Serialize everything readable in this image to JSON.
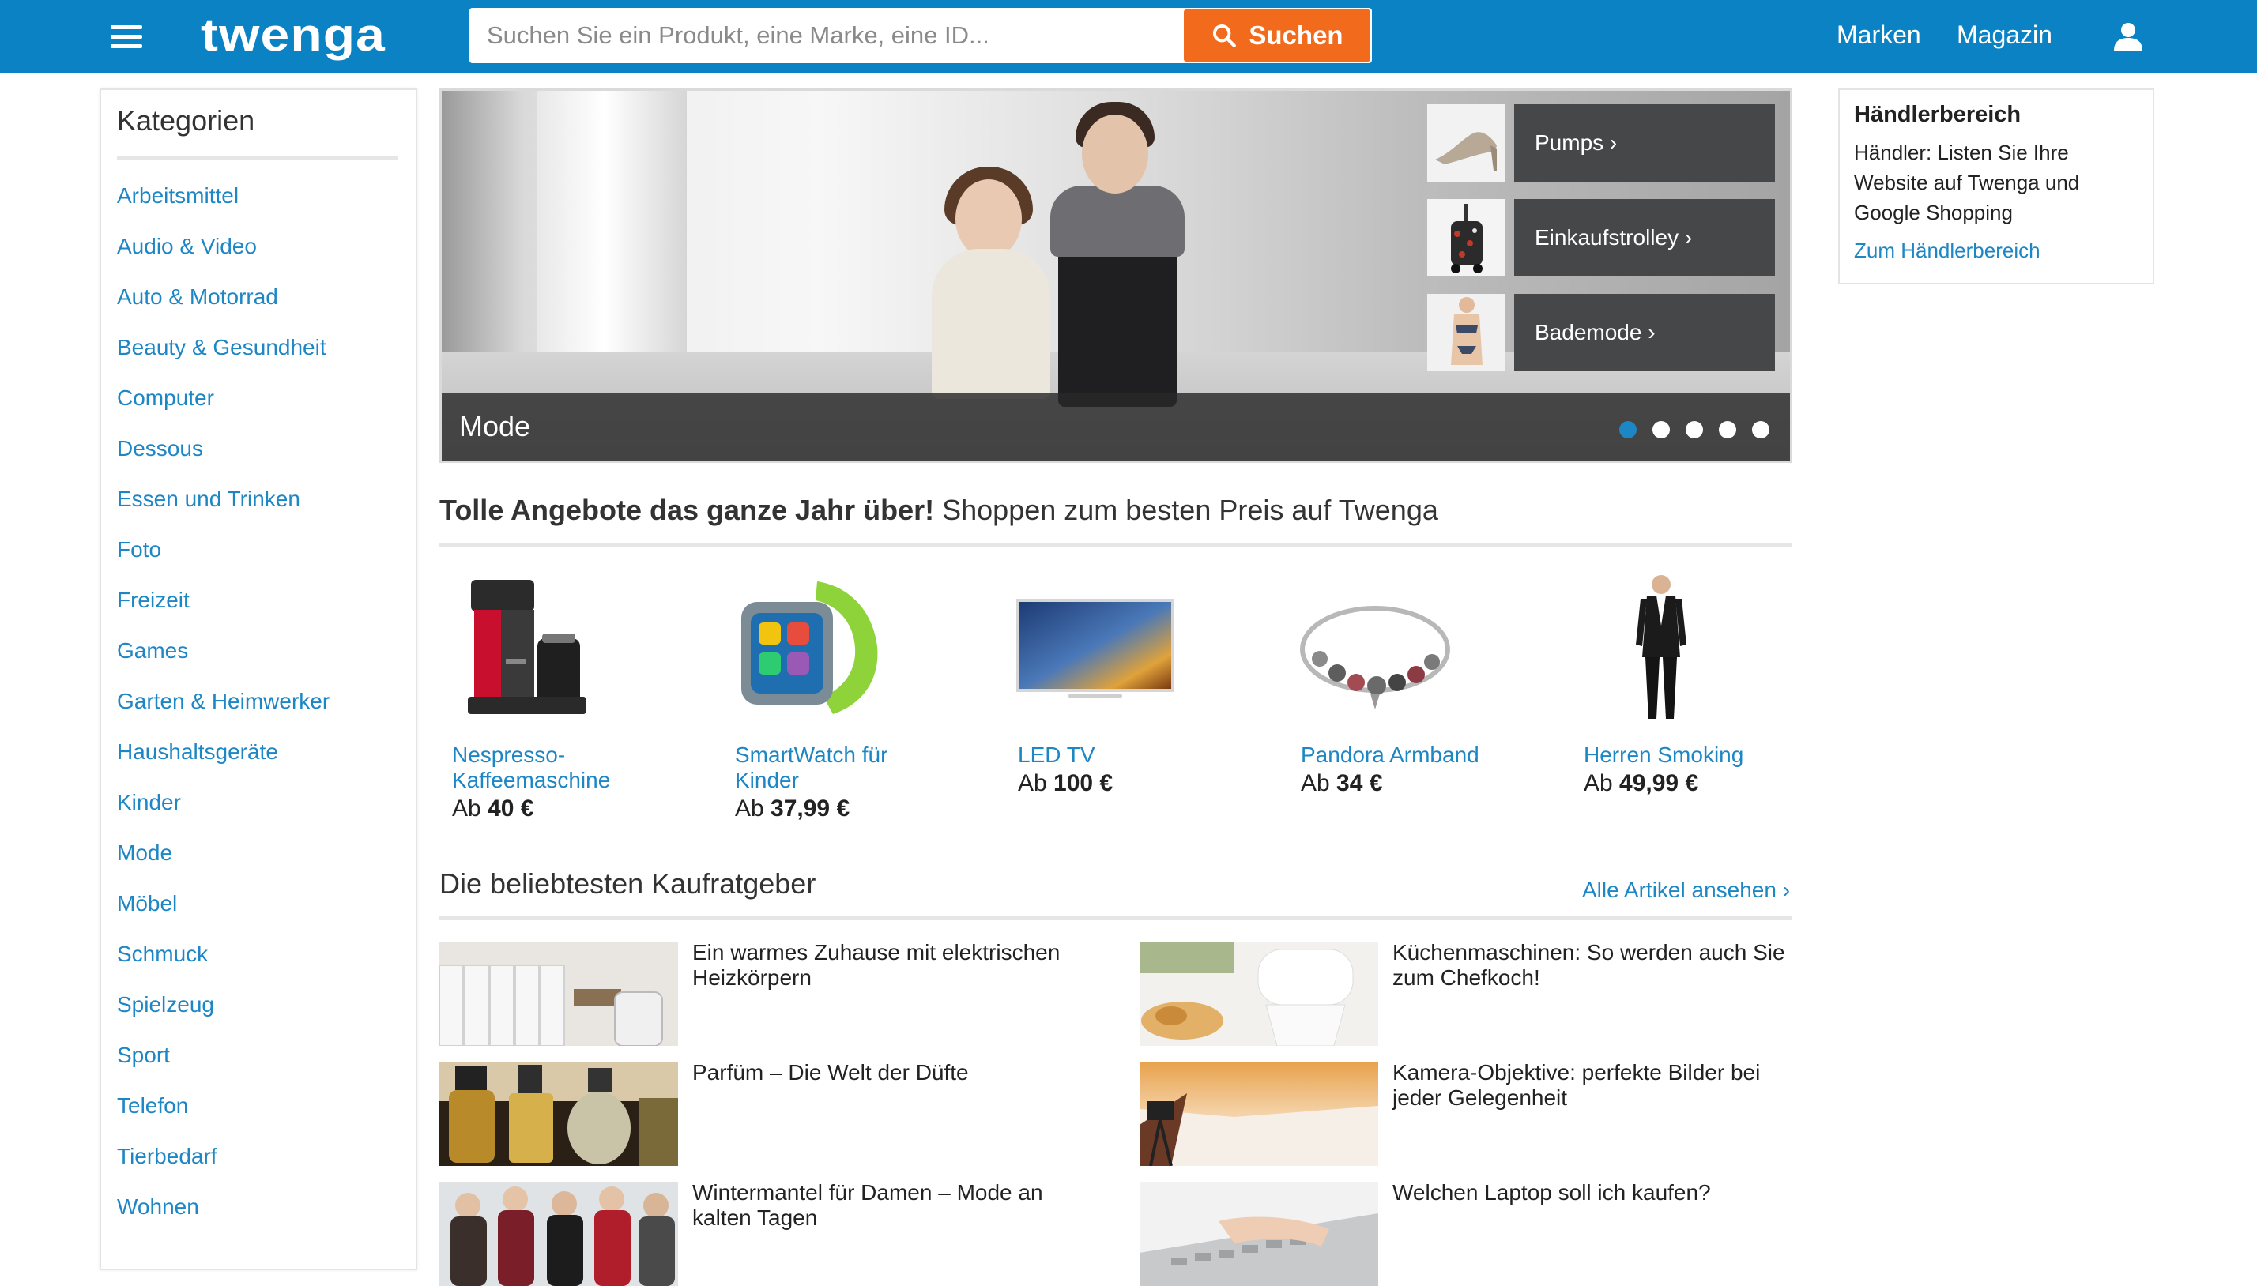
{
  "header": {
    "logo": "TWENGA",
    "search_placeholder": "Suchen Sie ein Produkt, eine Marke, eine ID...",
    "search_button": "Suchen",
    "nav": [
      "Marken",
      "Magazin"
    ]
  },
  "sidebar": {
    "title": "Kategorien",
    "categories": [
      "Arbeitsmittel",
      "Audio & Video",
      "Auto & Motorrad",
      "Beauty & Gesundheit",
      "Computer",
      "Dessous",
      "Essen und Trinken",
      "Foto",
      "Freizeit",
      "Games",
      "Garten & Heimwerker",
      "Haushaltsgeräte",
      "Kinder",
      "Mode",
      "Möbel",
      "Schmuck",
      "Spielzeug",
      "Sport",
      "Telefon",
      "Tierbedarf",
      "Wohnen"
    ]
  },
  "hero": {
    "caption": "Mode",
    "promos": [
      "Pumps ›",
      "Einkaufstrolley ›",
      "Bademode ›"
    ],
    "slide_count": 5,
    "active_slide": 1
  },
  "deals": {
    "heading_bold": "Tolle Angebote das ganze Jahr über!",
    "heading_rest": " Shoppen zum besten Preis auf Twenga",
    "products": [
      {
        "name": "Nespresso-Kaffeemaschine",
        "price_prefix": "Ab",
        "price": "40 €"
      },
      {
        "name": "SmartWatch für Kinder",
        "price_prefix": "Ab",
        "price": "37,99 €"
      },
      {
        "name": "LED TV",
        "price_prefix": "Ab",
        "price": "100 €"
      },
      {
        "name": "Pandora Armband",
        "price_prefix": "Ab",
        "price": "34 €"
      },
      {
        "name": "Herren Smoking",
        "price_prefix": "Ab",
        "price": "49,99 €"
      }
    ]
  },
  "guides": {
    "heading": "Die beliebtesten Kaufratgeber",
    "all_link": "Alle Artikel ansehen ›",
    "items": [
      "Ein warmes Zuhause mit elektrischen Heizkörpern",
      "Küchenmaschinen: So werden auch Sie zum Chefkoch!",
      "Parfüm – Die Welt der Düfte",
      "Kamera-Objektive: perfekte Bilder bei jeder Gelegenheit",
      "Wintermantel für Damen – Mode an kalten Tagen",
      "Welchen Laptop soll ich kaufen?"
    ]
  },
  "merchant": {
    "title": "Händlerbereich",
    "text": "Händler: Listen Sie Ihre Website auf Twenga und Google Shopping",
    "link": "Zum Händlerbereich"
  },
  "colors": {
    "header_bg": "#0b82c4",
    "accent_orange": "#f26a1b",
    "link_blue": "#1d86c5"
  }
}
